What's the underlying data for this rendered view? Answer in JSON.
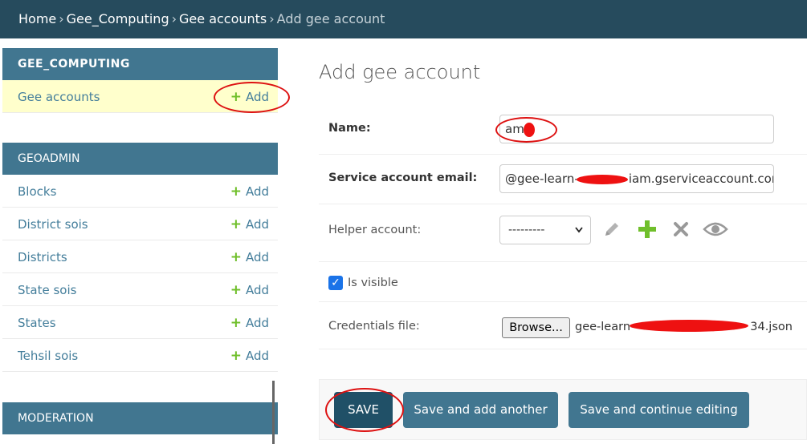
{
  "breadcrumb": {
    "items": [
      "Home",
      "Gee_Computing",
      "Gee accounts"
    ],
    "separator": "›",
    "current": "Add gee account"
  },
  "sidebar": {
    "add_label": "Add",
    "modules": [
      {
        "title": "GEE_COMPUTING",
        "models": [
          {
            "name": "Gee accounts",
            "active": true
          }
        ]
      },
      {
        "title": "GEOADMIN",
        "models": [
          {
            "name": "Blocks"
          },
          {
            "name": "District sois"
          },
          {
            "name": "Districts"
          },
          {
            "name": "State sois"
          },
          {
            "name": "States"
          },
          {
            "name": "Tehsil sois"
          }
        ]
      },
      {
        "title": "MODERATION",
        "models": []
      }
    ]
  },
  "form": {
    "title": "Add gee account",
    "name": {
      "label": "Name:",
      "value": "am"
    },
    "email": {
      "label": "Service account email:",
      "value_prefix": "@gee-learn-",
      "value_suffix": "iam.gserviceaccount.com"
    },
    "helper": {
      "label": "Helper account:",
      "selected": "---------"
    },
    "visible": {
      "label": "Is visible",
      "checked": true
    },
    "credentials": {
      "label": "Credentials file:",
      "browse_label": "Browse...",
      "file_prefix": "gee-learn-",
      "file_suffix": "34.json"
    }
  },
  "actions": {
    "save": "SAVE",
    "save_add": "Save and add another",
    "save_continue": "Save and continue editing"
  },
  "colors": {
    "header": "#264b5d",
    "module": "#417690",
    "link": "#447e9b",
    "add_plus": "#70bf2b",
    "annotation": "#dd1111"
  },
  "icons": [
    "pencil-icon",
    "plus-icon",
    "close-icon",
    "eye-icon",
    "chevron-down-icon",
    "checkmark-icon"
  ]
}
